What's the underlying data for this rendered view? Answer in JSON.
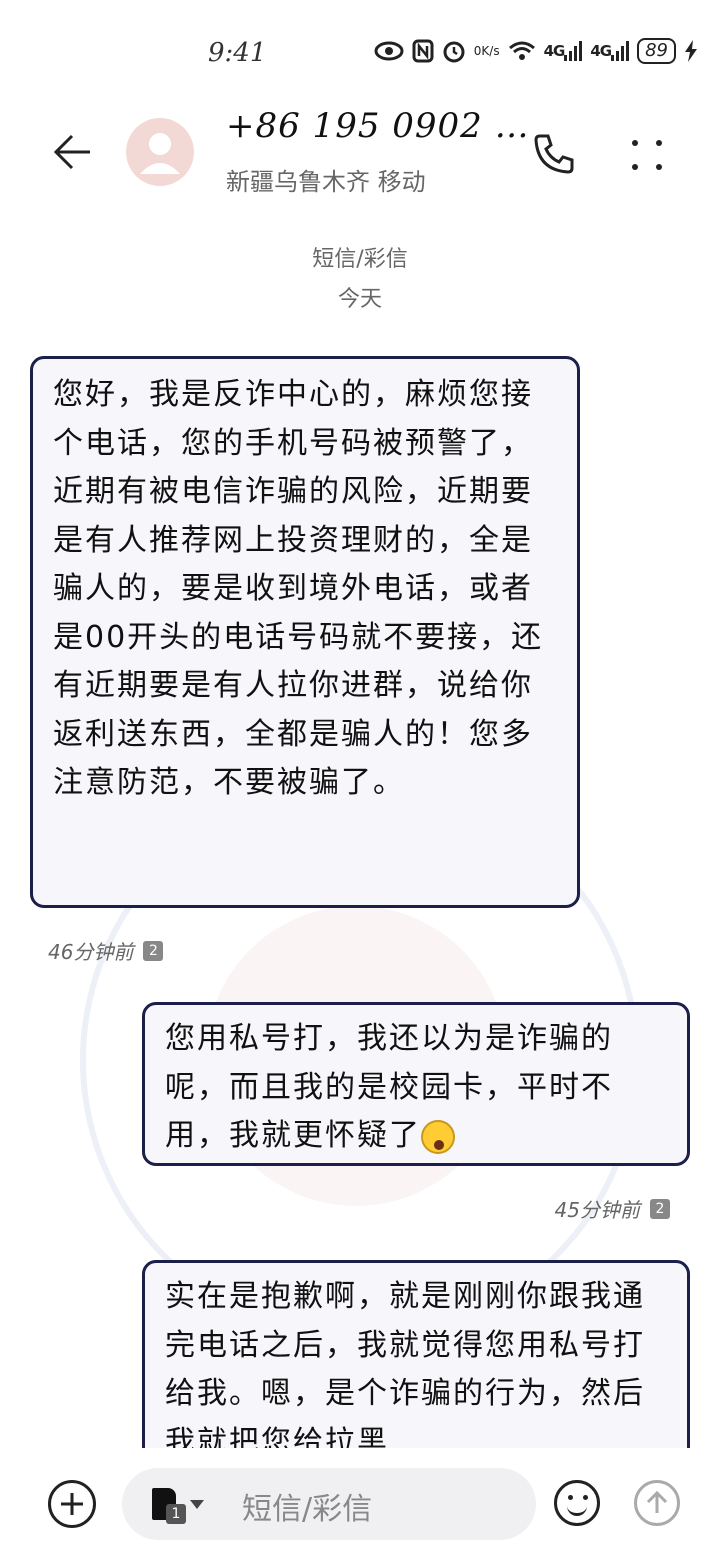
{
  "status_bar": {
    "time": "9:41",
    "net_speed_value": "0",
    "net_speed_unit": "K/s",
    "sim1_signal": "4G",
    "sim2_signal": "4G",
    "battery": "89",
    "icons": [
      "eye-icon",
      "nfc-icon",
      "alarm-icon",
      "wifi-icon",
      "signal-icon",
      "battery-icon",
      "charging-icon"
    ]
  },
  "header": {
    "contact_number": "+86 195 0902 …",
    "contact_location": "新疆乌鲁木齐 移动"
  },
  "thread": {
    "type_label": "短信/彩信",
    "date_label": "今天"
  },
  "messages": [
    {
      "direction": "incoming",
      "text": "您好，我是反诈中心的，麻烦您接个电话，您的手机号码被预警了，近期有被电信诈骗的风险，近期要是有人推荐网上投资理财的，全是骗人的，要是收到境外电话，或者是00开头的电话号码就不要接，还有近期要是有人拉你进群，说给你返利送东西，全都是骗人的！您多注意防范，不要被骗了。",
      "time": "46分钟前",
      "sim": "2"
    },
    {
      "direction": "outgoing",
      "text": "您用私号打，我还以为是诈骗的呢，而且我的是校园卡，平时不用，我就更怀疑了",
      "time": "45分钟前",
      "sim": "2"
    },
    {
      "direction": "outgoing",
      "text": "实在是抱歉啊，就是刚刚你跟我通完电话之后，我就觉得您用私号打给我。嗯，是个诈骗的行为，然后我就把您给拉黑"
    }
  ],
  "input_bar": {
    "sim_slot": "1",
    "placeholder": "短信/彩信"
  }
}
